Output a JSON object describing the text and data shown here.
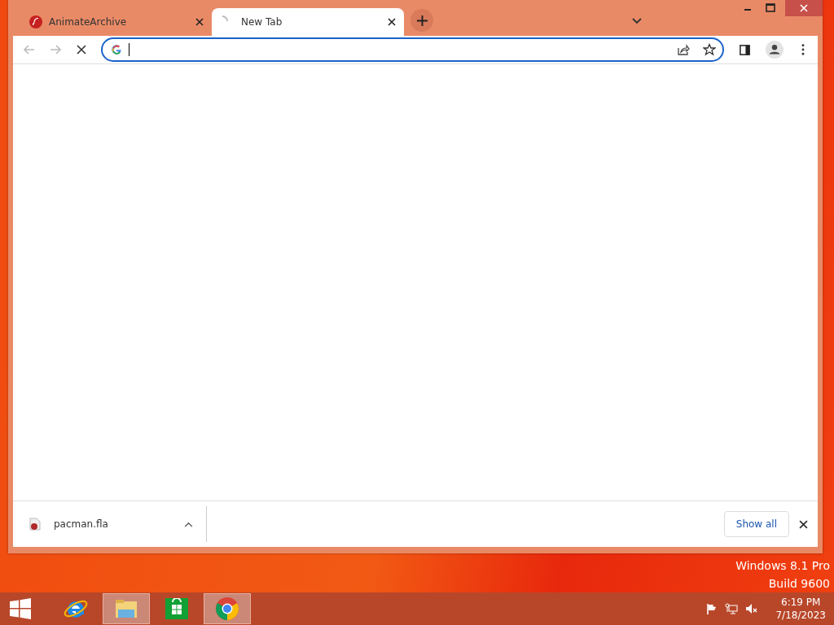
{
  "tabs": [
    {
      "kind": "flash",
      "title": "AnimateArchive",
      "selected": false
    },
    {
      "kind": "loading",
      "title": "New Tab",
      "selected": true
    }
  ],
  "navigation": [
    {
      "kind": "back",
      "disabled": true
    },
    {
      "kind": "forward",
      "disabled": true
    },
    {
      "kind": "stop",
      "disabled": false
    }
  ],
  "downloads": [
    {
      "filename": "pacman.fla"
    }
  ],
  "show_all": "Show all",
  "os_info": [
    "Windows 8.1 Pro",
    "Build 9600"
  ],
  "taskbar": [
    {
      "kind": "ie",
      "selected": false
    },
    {
      "kind": "explorer",
      "selected": true
    },
    {
      "kind": "store",
      "selected": false
    },
    {
      "kind": "chrome",
      "selected": true
    }
  ],
  "clock": {
    "time": "6:19 PM",
    "date": "7/18/2023"
  }
}
